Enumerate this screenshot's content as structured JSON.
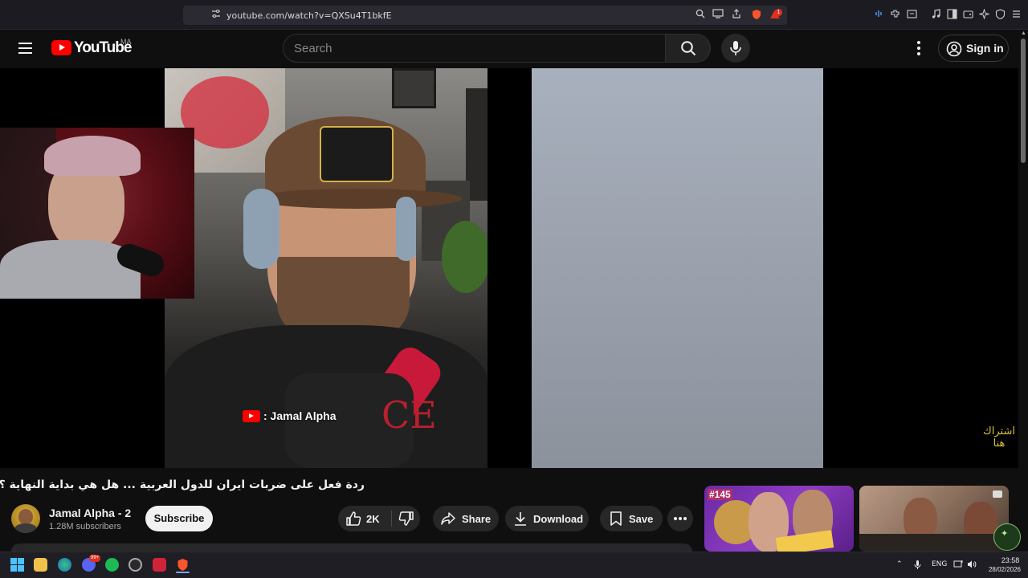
{
  "browser": {
    "url": "youtube.com/watch?v=QXSu4T1bkfE",
    "back_icon": "chevron-left-icon",
    "forward_icon": "chevron-right-icon",
    "reload_icon": "reload-icon",
    "shield_badge": "1"
  },
  "header": {
    "logo_text": "YouTube",
    "country_code": "MA",
    "search_placeholder": "Search",
    "signin_label": "Sign in"
  },
  "video": {
    "watermark_text": ": Jamal Alpha",
    "subscribe_overlay_line1": "اشتراك",
    "subscribe_overlay_line2": "هنا"
  },
  "details": {
    "title": "ردة فعل على ضربات ايران للدول العربية ... هل هي بداية النهاية ؟",
    "channel_name": "Jamal Alpha - 2",
    "subscribers": "1.28M subscribers",
    "subscribe_label": "Subscribe",
    "like_count": "2K",
    "share_label": "Share",
    "download_label": "Download",
    "save_label": "Save"
  },
  "recommendations": [
    {
      "badge": "#145"
    },
    {
      "badge": ""
    }
  ],
  "taskbar": {
    "language": "ENG",
    "time": "23:58",
    "date": "28/02/2026",
    "discord_badge": "99+"
  },
  "colors": {
    "brand_red": "#ff0000",
    "background": "#0f0f0f",
    "pill_bg": "#272727"
  }
}
